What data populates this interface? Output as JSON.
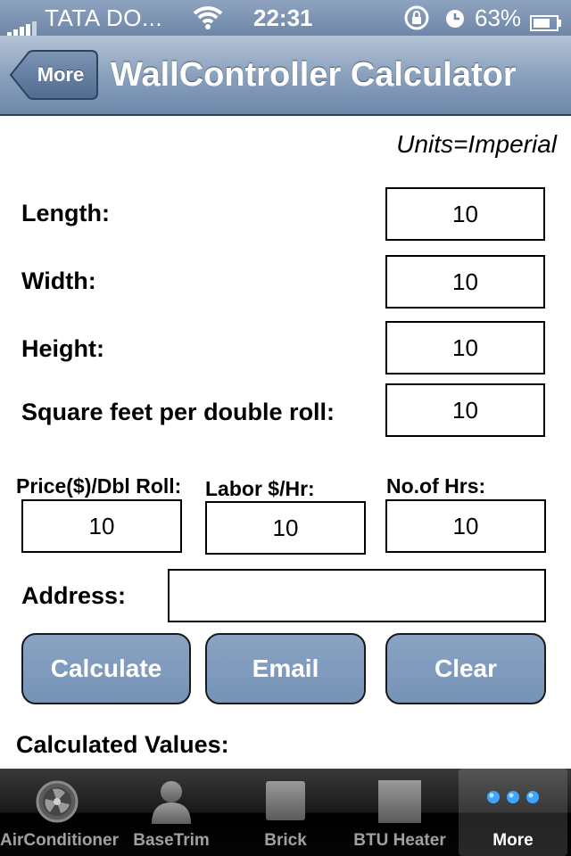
{
  "status_bar": {
    "carrier": "TATA DO...",
    "time": "22:31",
    "battery_percent": "63%"
  },
  "nav": {
    "back_label": "More",
    "title": "WallController Calculator"
  },
  "units_label": "Units=Imperial",
  "fields": {
    "length": {
      "label": "Length:",
      "value": "10"
    },
    "width": {
      "label": "Width:",
      "value": "10"
    },
    "height": {
      "label": "Height:",
      "value": "10"
    },
    "sqft_roll": {
      "label": "Square feet per double roll:",
      "value": "10"
    },
    "price_roll": {
      "label": "Price($)/Dbl Roll:",
      "value": "10"
    },
    "labor_rate": {
      "label": "Labor $/Hr:",
      "value": "10"
    },
    "num_hours": {
      "label": "No.of Hrs:",
      "value": "10"
    },
    "address": {
      "label": "Address:",
      "value": ""
    }
  },
  "buttons": {
    "calculate": "Calculate",
    "email": "Email",
    "clear": "Clear"
  },
  "calculated_title": "Calculated Values:",
  "tab_bar": {
    "tabs": [
      {
        "label": "AirConditioner",
        "icon": "fan-icon"
      },
      {
        "label": "BaseTrim",
        "icon": "basetrim-icon"
      },
      {
        "label": "Brick",
        "icon": "brick-icon"
      },
      {
        "label": "BTU Heater",
        "icon": "heater-icon"
      },
      {
        "label": "More",
        "icon": "more-dots-icon",
        "active": true
      }
    ]
  },
  "colors": {
    "nav_bar": "#8aa1bd",
    "button": "#7f9bbd",
    "tab_active_label": "#ffffff",
    "tab_inactive_label": "#a0a0a0"
  }
}
